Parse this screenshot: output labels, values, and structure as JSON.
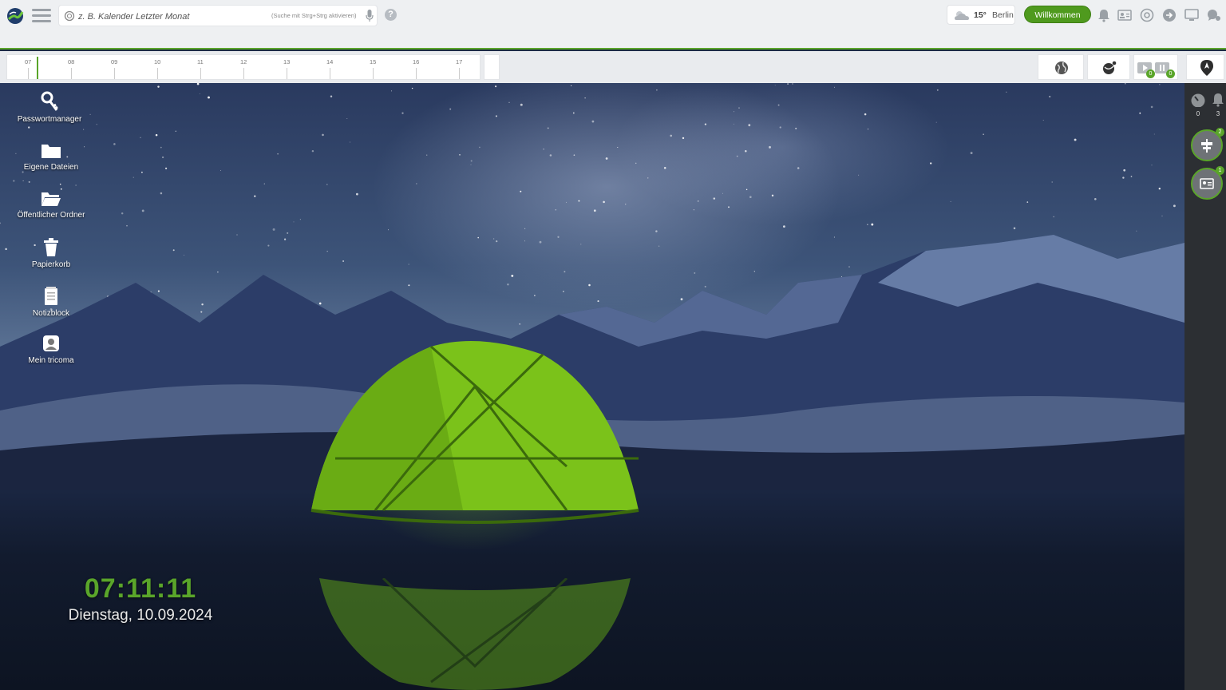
{
  "topbar": {
    "search": {
      "placeholder": "z. B. Kalender Letzter Monat",
      "hint": "(Suche mit Strg+Strg aktivieren)"
    },
    "help_icon_text": "?",
    "weather": {
      "temperature": "15°",
      "city": "Berlin",
      "icon": "partly-cloudy-icon"
    },
    "welcome_label": "Willkommen",
    "icons": [
      "bell-icon",
      "contacts-icon",
      "support-icon",
      "arrow-right-icon",
      "monitor-icon",
      "chat-icon"
    ]
  },
  "timeline": {
    "hours": [
      "07",
      "08",
      "09",
      "10",
      "11",
      "12",
      "13",
      "14",
      "15",
      "16",
      "17"
    ],
    "buttons": [
      {
        "name": "globe-button",
        "icon": "globe-icon"
      },
      {
        "name": "network-button",
        "icon": "network-icon"
      },
      {
        "name": "media-button",
        "icon": "media-icon",
        "badges": [
          "0",
          "0"
        ]
      },
      {
        "name": "navigation-button",
        "icon": "compass-icon"
      }
    ]
  },
  "desktop": {
    "icons": [
      {
        "label": "Passwortmanager",
        "icon": "key-icon"
      },
      {
        "label": "Eigene Dateien",
        "icon": "folder-icon"
      },
      {
        "label": "Öffentlicher Ordner",
        "icon": "open-folder-icon"
      },
      {
        "label": "Papierkorb",
        "icon": "trash-icon"
      },
      {
        "label": "Notizblock",
        "icon": "notepad-icon"
      },
      {
        "label": "Mein tricoma",
        "icon": "tricoma-icon"
      }
    ],
    "clock": {
      "time": "07:11:11",
      "date": "Dienstag, 10.09.2024"
    }
  },
  "sidebar": {
    "stats": [
      {
        "icon": "gauge-icon",
        "value": "0"
      },
      {
        "icon": "bell-icon",
        "value": "3"
      }
    ],
    "buttons": [
      {
        "icon": "signpost-icon",
        "badge": "2"
      },
      {
        "icon": "id-card-icon",
        "badge": "1"
      }
    ]
  },
  "colors": {
    "accent": "#5aa52a",
    "topbar_bg": "#eef0f2",
    "sidebar_bg": "#2c2f33"
  }
}
